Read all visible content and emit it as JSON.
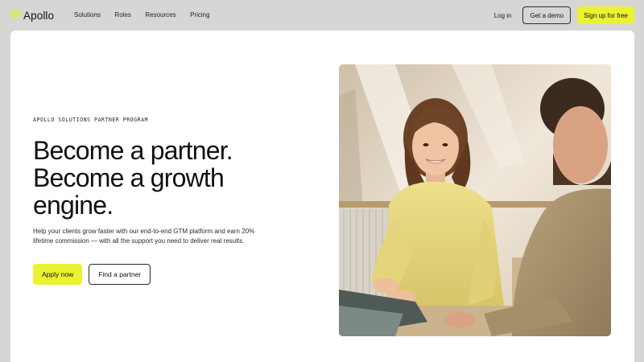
{
  "nav": {
    "logo_text": "Apollo",
    "links": [
      "Solutions",
      "Roles",
      "Resources",
      "Pricing"
    ],
    "login_label": "Log in",
    "demo_label": "Get a demo",
    "signup_label": "Sign up for free"
  },
  "hero": {
    "eyebrow": "APOLLO SOLUTIONS PARTNER PROGRAM",
    "headline_lines": [
      "Become a partner.",
      "Become a growth",
      "engine."
    ],
    "subtext": "Help your clients grow faster with our end-to-end GTM platform and earn 20% lifetime commission — with all the support you need to deliver real results.",
    "primary_cta": "Apply now",
    "secondary_cta": "Find a partner"
  },
  "colors": {
    "page_bg": "#d6d6d4",
    "accent": "#eaf231",
    "card_bg": "#ffffff",
    "text": "#111111"
  },
  "icons": {
    "logo": "sun-burst-icon"
  }
}
